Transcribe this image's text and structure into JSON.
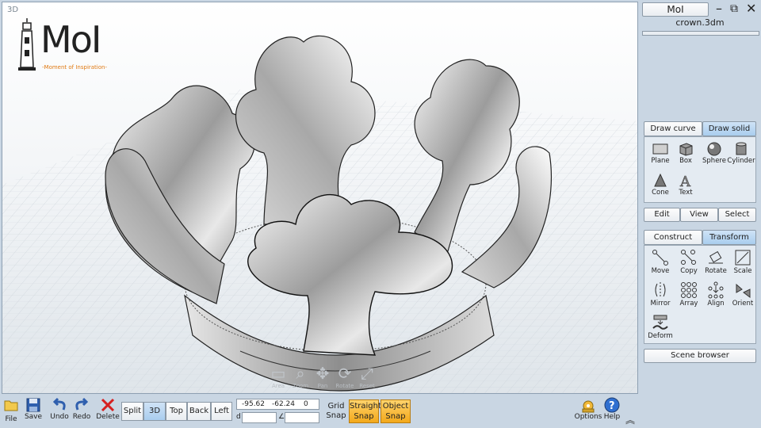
{
  "viewport": {
    "label": "3D",
    "logo_text": "MoI",
    "logo_tagline": "-Moment of Inspiration-",
    "nav": [
      {
        "label": "Area",
        "icon": "area-zoom-icon"
      },
      {
        "label": "Zoom",
        "icon": "zoom-icon"
      },
      {
        "label": "Pan",
        "icon": "pan-icon"
      },
      {
        "label": "Rotate",
        "icon": "rotate-icon"
      },
      {
        "label": "Reset",
        "icon": "reset-icon"
      }
    ]
  },
  "panel": {
    "app_button": "MoI",
    "filename": "crown.3dm",
    "draw_tabs": [
      "Draw curve",
      "Draw solid"
    ],
    "draw_active": "Draw solid",
    "solid_tools": [
      "Plane",
      "Box",
      "Sphere",
      "Cylinder",
      "Cone",
      "Text"
    ],
    "mid_tabs": [
      "Edit",
      "View",
      "Select"
    ],
    "mod_tabs": [
      "Construct",
      "Transform"
    ],
    "mod_active": "Transform",
    "transform_tools": [
      "Move",
      "Copy",
      "Rotate",
      "Scale",
      "Mirror",
      "Array",
      "Align",
      "Orient",
      "Deform"
    ],
    "scene_browser": "Scene browser"
  },
  "toolbar": {
    "file": "File",
    "save": "Save",
    "undo": "Undo",
    "redo": "Redo",
    "delete": "Delete",
    "views": [
      "Split",
      "3D",
      "Top",
      "Back",
      "Left"
    ],
    "active_view": "3D",
    "coord_x": "-95.62",
    "coord_y": "-62.24",
    "coord_z": "0",
    "distance_label": "d",
    "angle_label": "∠",
    "grid_snap": [
      "Grid",
      "Snap"
    ],
    "straight_snap": [
      "Straight",
      "Snap"
    ],
    "object_snap": [
      "Object",
      "Snap"
    ],
    "options": "Options",
    "help": "Help"
  },
  "colors": {
    "panel_bg": "#c9d6e3",
    "active_tab": "#a9cdee",
    "snap_active": "#f3a91b",
    "logo_accent": "#e07a12"
  }
}
